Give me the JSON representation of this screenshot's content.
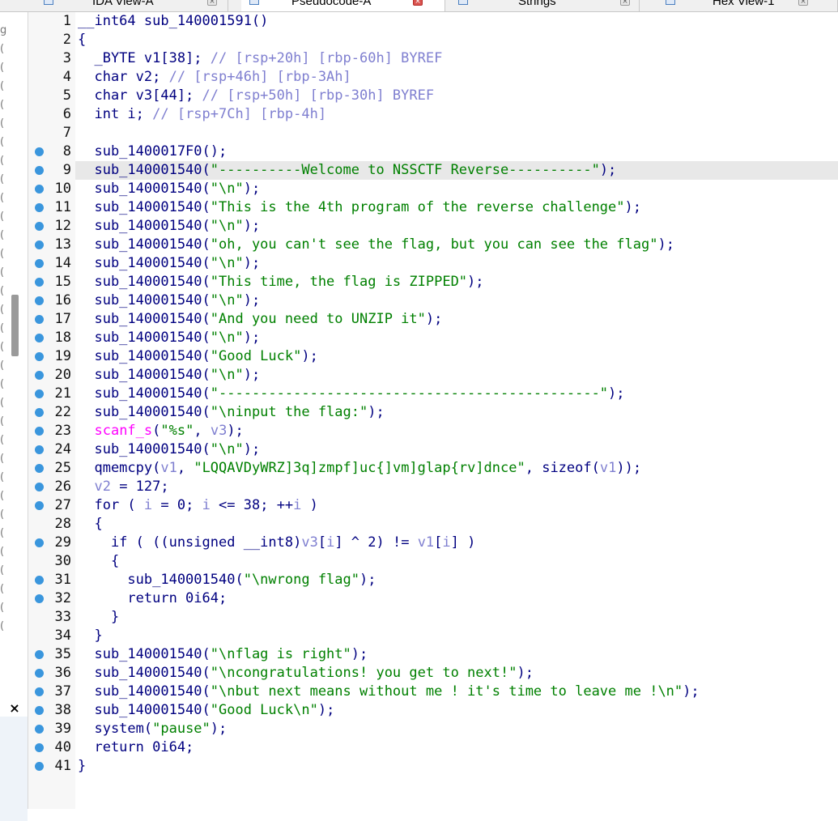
{
  "tabs": [
    {
      "label": "IDA View-A",
      "active": false
    },
    {
      "label": "Pseudocode-A",
      "active": true
    },
    {
      "label": "Strings",
      "active": false
    },
    {
      "label": "Hex View-1",
      "active": false
    }
  ],
  "left_strip_glyphs": [
    "g",
    "(",
    "(",
    "(",
    "(",
    "(",
    "(",
    "(",
    "(",
    "(",
    "(",
    "(",
    "(",
    "(",
    "(",
    "(",
    "(",
    "(",
    "(",
    "(",
    "(",
    "(",
    "(",
    "(",
    "(",
    "(",
    "(",
    "(",
    "(",
    "(",
    "(",
    "(",
    "("
  ],
  "left_strip_close": "×",
  "colors": {
    "default": "#000080",
    "string": "#008000",
    "variable": "#7f7fd0",
    "comment": "#7f7fd0",
    "import": "#ff00ff",
    "breakpoint_dot": "#3a96dd",
    "highlight": "#e8e8e8"
  },
  "code_lines": [
    {
      "n": "1",
      "bp": false,
      "segs": [
        [
          "d",
          "__int64 sub_140001591()"
        ]
      ]
    },
    {
      "n": "2",
      "bp": false,
      "segs": [
        [
          "d",
          "{"
        ]
      ]
    },
    {
      "n": "3",
      "bp": false,
      "segs": [
        [
          "d",
          "  _BYTE v1[38]; "
        ],
        [
          "c",
          "// [rsp+20h] [rbp-60h] BYREF"
        ]
      ]
    },
    {
      "n": "4",
      "bp": false,
      "segs": [
        [
          "d",
          "  char v2; "
        ],
        [
          "c",
          "// [rsp+46h] [rbp-3Ah]"
        ]
      ]
    },
    {
      "n": "5",
      "bp": false,
      "segs": [
        [
          "d",
          "  char v3[44]; "
        ],
        [
          "c",
          "// [rsp+50h] [rbp-30h] BYREF"
        ]
      ]
    },
    {
      "n": "6",
      "bp": false,
      "segs": [
        [
          "d",
          "  int i; "
        ],
        [
          "c",
          "// [rsp+7Ch] [rbp-4h]"
        ]
      ]
    },
    {
      "n": "7",
      "bp": false,
      "segs": []
    },
    {
      "n": "8",
      "bp": true,
      "segs": [
        [
          "d",
          "  sub_1400017F0();"
        ]
      ]
    },
    {
      "n": "9",
      "bp": true,
      "hl": true,
      "segs": [
        [
          "d",
          "  sub_140001540("
        ],
        [
          "s",
          "\"----------Welcome to NSSCTF Reverse----------\""
        ],
        [
          "d",
          ");"
        ]
      ]
    },
    {
      "n": "10",
      "bp": true,
      "segs": [
        [
          "d",
          "  sub_140001540("
        ],
        [
          "s",
          "\"\\n\""
        ],
        [
          "d",
          ");"
        ]
      ]
    },
    {
      "n": "11",
      "bp": true,
      "segs": [
        [
          "d",
          "  sub_140001540("
        ],
        [
          "s",
          "\"This is the 4th program of the reverse challenge\""
        ],
        [
          "d",
          ");"
        ]
      ]
    },
    {
      "n": "12",
      "bp": true,
      "segs": [
        [
          "d",
          "  sub_140001540("
        ],
        [
          "s",
          "\"\\n\""
        ],
        [
          "d",
          ");"
        ]
      ]
    },
    {
      "n": "13",
      "bp": true,
      "segs": [
        [
          "d",
          "  sub_140001540("
        ],
        [
          "s",
          "\"oh, you can't see the flag, but you can see the flag\""
        ],
        [
          "d",
          ");"
        ]
      ]
    },
    {
      "n": "14",
      "bp": true,
      "segs": [
        [
          "d",
          "  sub_140001540("
        ],
        [
          "s",
          "\"\\n\""
        ],
        [
          "d",
          ");"
        ]
      ]
    },
    {
      "n": "15",
      "bp": true,
      "segs": [
        [
          "d",
          "  sub_140001540("
        ],
        [
          "s",
          "\"This time, the flag is ZIPPED\""
        ],
        [
          "d",
          ");"
        ]
      ]
    },
    {
      "n": "16",
      "bp": true,
      "segs": [
        [
          "d",
          "  sub_140001540("
        ],
        [
          "s",
          "\"\\n\""
        ],
        [
          "d",
          ");"
        ]
      ]
    },
    {
      "n": "17",
      "bp": true,
      "segs": [
        [
          "d",
          "  sub_140001540("
        ],
        [
          "s",
          "\"And you need to UNZIP it\""
        ],
        [
          "d",
          ");"
        ]
      ]
    },
    {
      "n": "18",
      "bp": true,
      "segs": [
        [
          "d",
          "  sub_140001540("
        ],
        [
          "s",
          "\"\\n\""
        ],
        [
          "d",
          ");"
        ]
      ]
    },
    {
      "n": "19",
      "bp": true,
      "segs": [
        [
          "d",
          "  sub_140001540("
        ],
        [
          "s",
          "\"Good Luck\""
        ],
        [
          "d",
          ");"
        ]
      ]
    },
    {
      "n": "20",
      "bp": true,
      "segs": [
        [
          "d",
          "  sub_140001540("
        ],
        [
          "s",
          "\"\\n\""
        ],
        [
          "d",
          ");"
        ]
      ]
    },
    {
      "n": "21",
      "bp": true,
      "segs": [
        [
          "d",
          "  sub_140001540("
        ],
        [
          "s",
          "\"----------------------------------------------\""
        ],
        [
          "d",
          ");"
        ]
      ]
    },
    {
      "n": "22",
      "bp": true,
      "segs": [
        [
          "d",
          "  sub_140001540("
        ],
        [
          "s",
          "\"\\ninput the flag:\""
        ],
        [
          "d",
          ");"
        ]
      ]
    },
    {
      "n": "23",
      "bp": true,
      "segs": [
        [
          "d",
          "  "
        ],
        [
          "i",
          "scanf_s"
        ],
        [
          "d",
          "("
        ],
        [
          "s",
          "\"%s\""
        ],
        [
          "d",
          ", "
        ],
        [
          "v",
          "v3"
        ],
        [
          "d",
          ");"
        ]
      ]
    },
    {
      "n": "24",
      "bp": true,
      "segs": [
        [
          "d",
          "  sub_140001540("
        ],
        [
          "s",
          "\"\\n\""
        ],
        [
          "d",
          ");"
        ]
      ]
    },
    {
      "n": "25",
      "bp": true,
      "segs": [
        [
          "d",
          "  qmemcpy("
        ],
        [
          "v",
          "v1"
        ],
        [
          "d",
          ", "
        ],
        [
          "s",
          "\"LQQAVDyWRZ]3q]zmpf]uc{]vm]glap{rv]dnce\""
        ],
        [
          "d",
          ", sizeof("
        ],
        [
          "v",
          "v1"
        ],
        [
          "d",
          "));"
        ]
      ]
    },
    {
      "n": "26",
      "bp": true,
      "segs": [
        [
          "d",
          "  "
        ],
        [
          "v",
          "v2"
        ],
        [
          "d",
          " = 127;"
        ]
      ]
    },
    {
      "n": "27",
      "bp": true,
      "segs": [
        [
          "d",
          "  for ( "
        ],
        [
          "v",
          "i"
        ],
        [
          "d",
          " = 0; "
        ],
        [
          "v",
          "i"
        ],
        [
          "d",
          " <= 38; ++"
        ],
        [
          "v",
          "i"
        ],
        [
          "d",
          " )"
        ]
      ]
    },
    {
      "n": "28",
      "bp": false,
      "segs": [
        [
          "d",
          "  {"
        ]
      ]
    },
    {
      "n": "29",
      "bp": true,
      "segs": [
        [
          "d",
          "    if ( ((unsigned __int8)"
        ],
        [
          "v",
          "v3"
        ],
        [
          "d",
          "["
        ],
        [
          "v",
          "i"
        ],
        [
          "d",
          "] ^ 2) != "
        ],
        [
          "v",
          "v1"
        ],
        [
          "d",
          "["
        ],
        [
          "v",
          "i"
        ],
        [
          "d",
          "] )"
        ]
      ]
    },
    {
      "n": "30",
      "bp": false,
      "segs": [
        [
          "d",
          "    {"
        ]
      ]
    },
    {
      "n": "31",
      "bp": true,
      "segs": [
        [
          "d",
          "      sub_140001540("
        ],
        [
          "s",
          "\"\\nwrong flag\""
        ],
        [
          "d",
          ");"
        ]
      ]
    },
    {
      "n": "32",
      "bp": true,
      "segs": [
        [
          "d",
          "      return 0i64;"
        ]
      ]
    },
    {
      "n": "33",
      "bp": false,
      "segs": [
        [
          "d",
          "    }"
        ]
      ]
    },
    {
      "n": "34",
      "bp": false,
      "segs": [
        [
          "d",
          "  }"
        ]
      ]
    },
    {
      "n": "35",
      "bp": true,
      "segs": [
        [
          "d",
          "  sub_140001540("
        ],
        [
          "s",
          "\"\\nflag is right\""
        ],
        [
          "d",
          ");"
        ]
      ]
    },
    {
      "n": "36",
      "bp": true,
      "segs": [
        [
          "d",
          "  sub_140001540("
        ],
        [
          "s",
          "\"\\ncongratulations! you get to next!\""
        ],
        [
          "d",
          ");"
        ]
      ]
    },
    {
      "n": "37",
      "bp": true,
      "segs": [
        [
          "d",
          "  sub_140001540("
        ],
        [
          "s",
          "\"\\nbut next means without me ! it's time to leave me !\\n\""
        ],
        [
          "d",
          ");"
        ]
      ]
    },
    {
      "n": "38",
      "bp": true,
      "segs": [
        [
          "d",
          "  sub_140001540("
        ],
        [
          "s",
          "\"Good Luck\\n\""
        ],
        [
          "d",
          ");"
        ]
      ]
    },
    {
      "n": "39",
      "bp": true,
      "segs": [
        [
          "d",
          "  system("
        ],
        [
          "s",
          "\"pause\""
        ],
        [
          "d",
          ");"
        ]
      ]
    },
    {
      "n": "40",
      "bp": true,
      "segs": [
        [
          "d",
          "  return 0i64;"
        ]
      ]
    },
    {
      "n": "41",
      "bp": true,
      "segs": [
        [
          "d",
          "}"
        ]
      ]
    }
  ]
}
